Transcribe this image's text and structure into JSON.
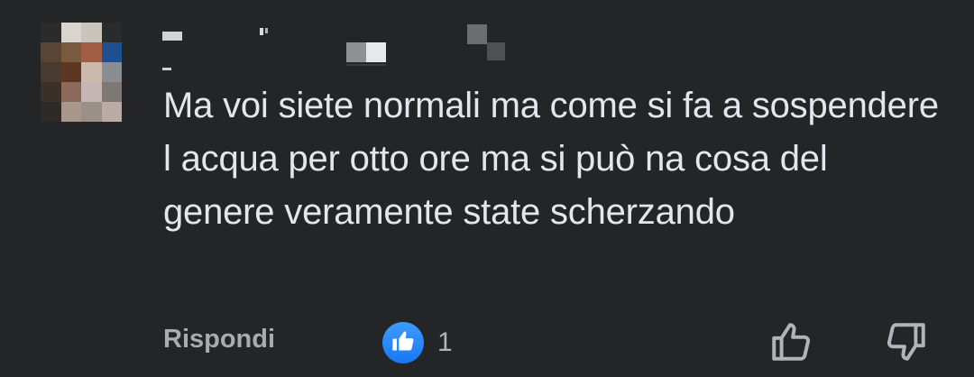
{
  "comment": {
    "text": "Ma voi siete normali ma come si fa a sospendere l acqua per otto ore ma si può na cosa del genere veramente state scherzando",
    "avatar_pixels": [
      "#2b2b2c",
      "#d8d4ce",
      "#c9c5be",
      "#2a2b2d",
      "#5a4434",
      "#7a5a3c",
      "#a15d44",
      "#1e4f8e",
      "#4a3a2e",
      "#5c3822",
      "#cbb9ac",
      "#8a8e93",
      "#3a3028",
      "#8a6a58",
      "#c4b6b4",
      "#7f7774",
      "#2e2a28",
      "#a8988c",
      "#9a9088",
      "#b8aca4"
    ]
  },
  "actions": {
    "reply_label": "Rispondi",
    "like_count": "1",
    "like_badge_color": "#1877f2",
    "icons": {
      "like_badge": "thumbs-up-icon",
      "thumb_up": "thumbs-up-outline-icon",
      "thumb_down": "thumbs-down-outline-icon"
    }
  }
}
